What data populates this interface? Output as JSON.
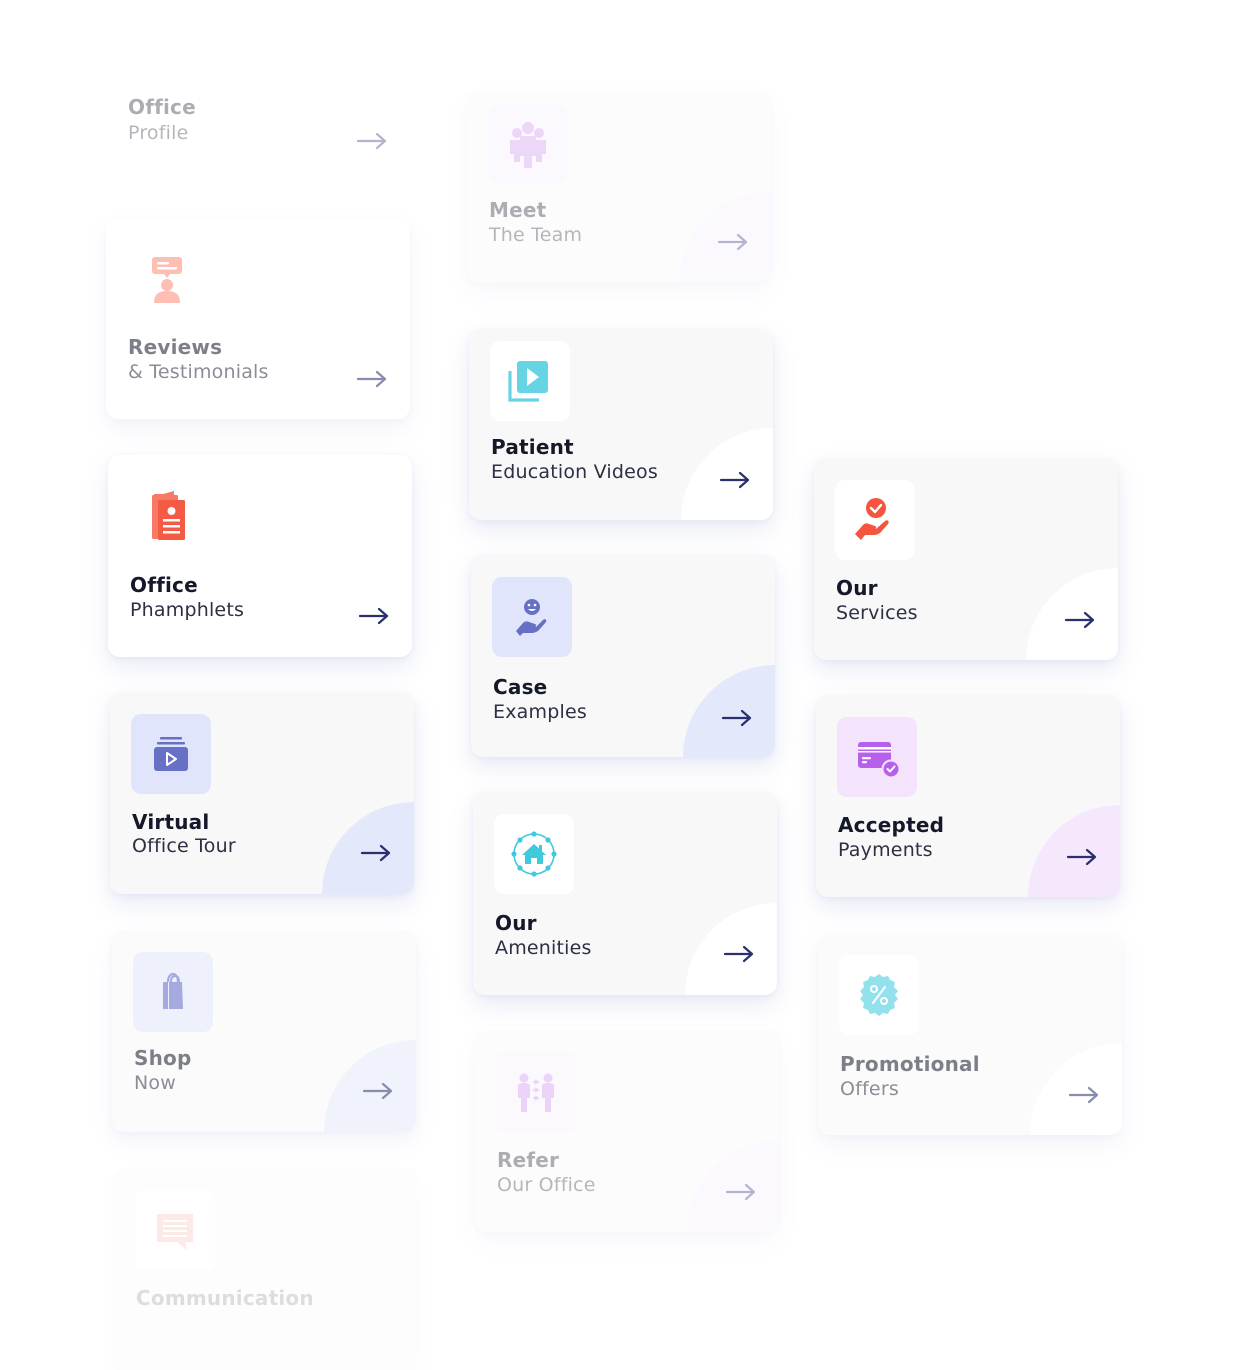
{
  "cards": {
    "office_profile": {
      "title": "Office",
      "subtitle": "Profile",
      "icon": "none"
    },
    "reviews": {
      "title": "Reviews",
      "subtitle": "& Testimonials",
      "icon": "reviews-person-icon",
      "icon_color": "#ff8a78"
    },
    "pamphlets": {
      "title": "Office",
      "subtitle": "Phamphlets",
      "icon": "pamphlet-icon",
      "icon_color": "#f55a45"
    },
    "virtual_tour": {
      "title": "Virtual",
      "subtitle": "Office Tour",
      "icon": "video-tour-icon",
      "icon_color": "#6670c4",
      "icon_bg": "#e1e5fb",
      "blob_color": "#e4e8fb"
    },
    "shop": {
      "title": "Shop",
      "subtitle": "Now",
      "icon": "shopping-bag-icon",
      "icon_color": "#5a66c6",
      "icon_bg": "#e1e5fb",
      "blob_color": "#e4e8fb"
    },
    "communication": {
      "title": "Communication",
      "subtitle": "",
      "icon": "chat-bubble-icon",
      "icon_color": "#f26a55"
    },
    "meet_team": {
      "title": "Meet",
      "subtitle": "The Team",
      "icon": "team-icon",
      "icon_color": "#c98ef0",
      "icon_bg": "#f6ecfd",
      "blob_color": "#f5ecfd"
    },
    "patient_videos": {
      "title": "Patient",
      "subtitle": "Education Videos",
      "icon": "video-library-icon",
      "icon_color": "#66d4e3"
    },
    "case_examples": {
      "title": "Case",
      "subtitle": "Examples",
      "icon": "smile-hand-icon",
      "icon_color": "#6670c4",
      "icon_bg": "#e1e5fb",
      "blob_color": "#e4e8fb"
    },
    "amenities": {
      "title": "Our",
      "subtitle": "Amenities",
      "icon": "home-network-icon",
      "icon_color": "#3fc9dd"
    },
    "refer": {
      "title": "Refer",
      "subtitle": "Our Office",
      "icon": "referral-icon",
      "icon_color": "#c984f2",
      "icon_bg": "#f6ecfd",
      "blob_color": "#f5ecfd"
    },
    "services": {
      "title": "Our",
      "subtitle": "Services",
      "icon": "service-hand-check-icon",
      "icon_color": "#f5543e"
    },
    "payments": {
      "title": "Accepted",
      "subtitle": "Payments",
      "icon": "credit-card-check-icon",
      "icon_color": "#b760ec",
      "icon_bg": "#f3e3fd",
      "blob_color": "#f5e8fd"
    },
    "promotions": {
      "title": "Promotional",
      "subtitle": "Offers",
      "icon": "discount-badge-icon",
      "icon_color": "#3cc9dd"
    }
  },
  "colors": {
    "arrow": "#2a2f6e",
    "title": "#141828",
    "subtitle": "#2c3042"
  }
}
